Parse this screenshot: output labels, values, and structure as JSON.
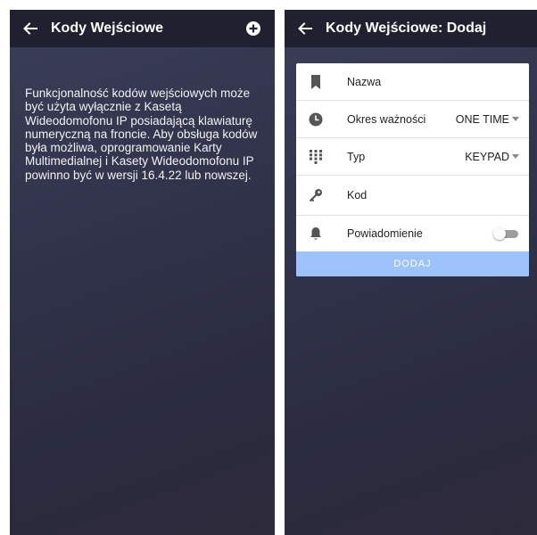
{
  "left_screen": {
    "title": "Kody Wejściowe",
    "info_text": "Funkcjonalność kodów wejściowych może być użyta wyłącznie z Kasetą Wideodomofonu IP posiadającą klawiaturę numeryczną na froncie. Aby obsługa kodów była możliwa, oprogramowanie Karty Multimedialnej i Kasety Wideodomofonu IP powinno być w wersji 16.4.22 lub nowszej."
  },
  "right_screen": {
    "title": "Kody Wejściowe: Dodaj",
    "form": {
      "name_label": "Nazwa",
      "validity_label": "Okres ważności",
      "validity_value": "ONE TIME",
      "type_label": "Typ",
      "type_value": "KEYPAD",
      "code_label": "Kod",
      "notification_label": "Powiadomienie",
      "notification_enabled": false,
      "submit_label": "DODAJ"
    }
  },
  "colors": {
    "appbar": "#1f2130",
    "background": "#33354c",
    "submit_button": "#9ec3fa",
    "icon": "#555555",
    "text_light": "#f2f2f4"
  },
  "icons": {
    "back": "arrow-left-icon",
    "add": "plus-circle-icon",
    "name": "bookmark-icon",
    "validity": "clock-icon",
    "type": "keypad-icon",
    "code": "key-icon",
    "notification": "bell-icon"
  }
}
